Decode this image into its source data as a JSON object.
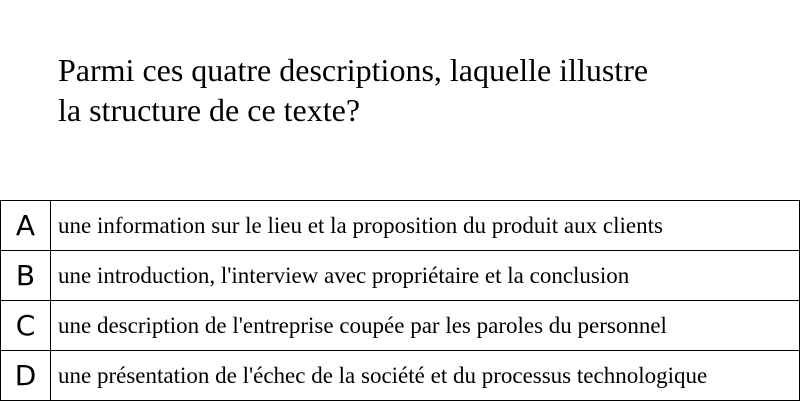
{
  "question": {
    "line1": "Parmi ces quatre descriptions, laquelle illustre",
    "line2": "la structure de ce texte?"
  },
  "options": [
    {
      "letter": "A",
      "text": "une information sur le lieu et la proposition du produit aux clients"
    },
    {
      "letter": "B",
      "text": "une introduction, l'interview avec propriétaire et la conclusion"
    },
    {
      "letter": "C",
      "text": "une description de l'entreprise coupée par les paroles du personnel"
    },
    {
      "letter": "D",
      "text": "une présentation de l'échec de la société et du processus technologique"
    }
  ]
}
